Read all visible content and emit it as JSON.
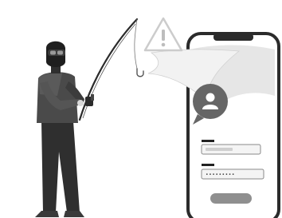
{
  "illustration": {
    "subject": "phishing",
    "icons": [
      "warning-icon",
      "user-icon",
      "fishing-hook-icon"
    ],
    "phone_form": {
      "password_mask": "•••••••••",
      "login_button_label": ""
    },
    "colors": {
      "outline": "#2b2b2b",
      "hacker_dark": "#2f2f2f",
      "hacker_mid": "#4a4a4a",
      "phone_screen": "#ffffff",
      "phone_fold": "#e6e6e6",
      "avatar_bubble": "#666666",
      "field_fill": "#f4f4f4",
      "field_bar": "#cfcfcf",
      "button_fill": "#8f8f8f",
      "label_bar": "#222222"
    }
  }
}
